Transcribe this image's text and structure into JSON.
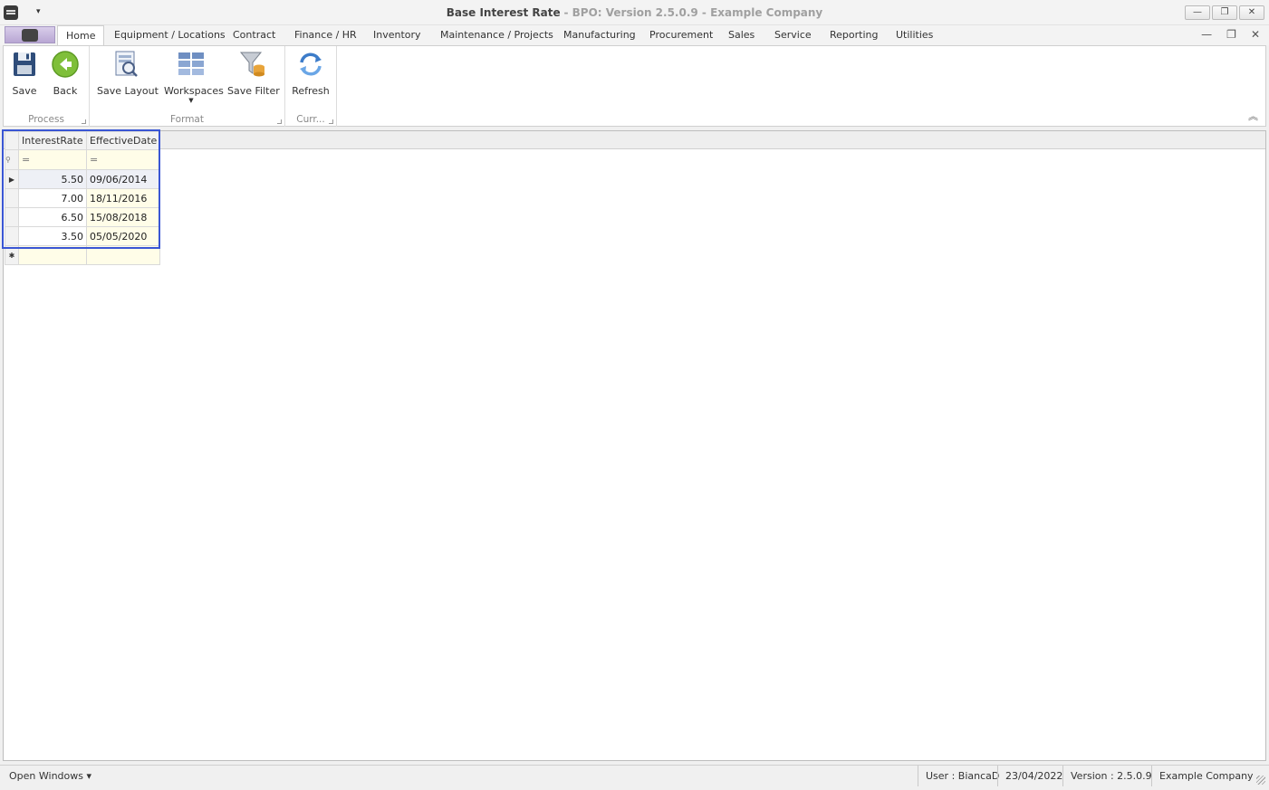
{
  "window": {
    "title_main": "Base Interest Rate",
    "title_sub": "- BPO: Version 2.5.0.9 - Example Company",
    "qat_arrow": "▾",
    "controls": {
      "minimize": "—",
      "maximize": "❐",
      "close": "✕"
    },
    "mdi_controls": {
      "minimize": "—",
      "restore": "❐",
      "close": "✕"
    }
  },
  "tabs": [
    {
      "label": "Home"
    },
    {
      "label": "Equipment / Locations"
    },
    {
      "label": "Contract"
    },
    {
      "label": "Finance / HR"
    },
    {
      "label": "Inventory"
    },
    {
      "label": "Maintenance / Projects"
    },
    {
      "label": "Manufacturing"
    },
    {
      "label": "Procurement"
    },
    {
      "label": "Sales"
    },
    {
      "label": "Service"
    },
    {
      "label": "Reporting"
    },
    {
      "label": "Utilities"
    }
  ],
  "ribbon": {
    "groups": {
      "process": "Process",
      "format": "Format",
      "current": "Curr..."
    },
    "buttons": {
      "save": "Save",
      "back": "Back",
      "save_layout": "Save Layout",
      "workspaces": "Workspaces",
      "workspaces_arrow": "▼",
      "save_filter": "Save Filter",
      "refresh": "Refresh"
    },
    "collapse_glyph": "︽"
  },
  "grid": {
    "columns": [
      "InterestRate",
      "EffectiveDate"
    ],
    "filter_glyph": "⚲",
    "filter_values": [
      "=",
      "="
    ],
    "current_row_glyph": "▶",
    "new_row_glyph": "✱",
    "rows": [
      {
        "rate": "5.50",
        "date": "09/06/2014"
      },
      {
        "rate": "7.00",
        "date": "18/11/2016"
      },
      {
        "rate": "6.50",
        "date": "15/08/2018"
      },
      {
        "rate": "3.50",
        "date": "05/05/2020"
      }
    ]
  },
  "status": {
    "open_windows": "Open Windows ▾",
    "user": "User : BiancaD",
    "date": "23/04/2022",
    "version": "Version : 2.5.0.9",
    "company": "Example Company"
  },
  "colors": {
    "accent": "#3a56d4",
    "filter_row": "#fffde8"
  }
}
